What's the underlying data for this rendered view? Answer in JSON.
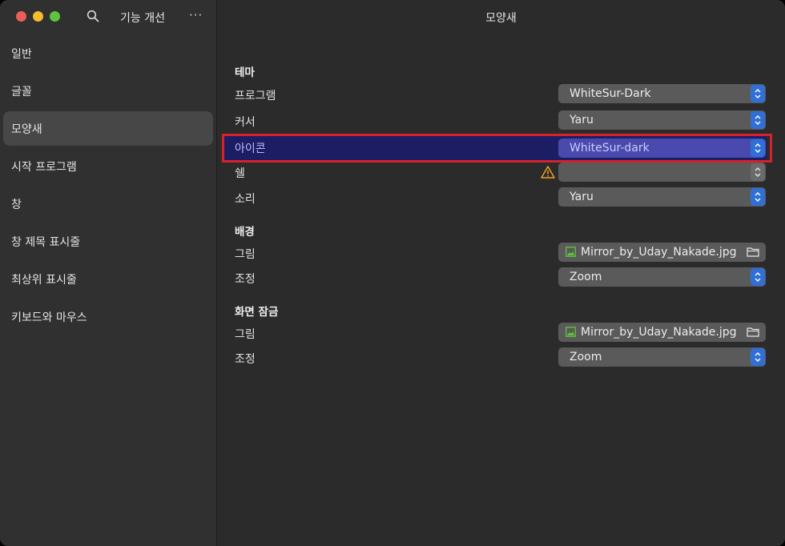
{
  "sidebar": {
    "title": "기능 개선",
    "more_label": "···",
    "items": [
      {
        "label": "일반"
      },
      {
        "label": "글꼴"
      },
      {
        "label": "모양새"
      },
      {
        "label": "시작 프로그램"
      },
      {
        "label": "창"
      },
      {
        "label": "창 제목 표시줄"
      },
      {
        "label": "최상위 표시줄"
      },
      {
        "label": "키보드와 마우스"
      }
    ],
    "active_index": 2
  },
  "main": {
    "title": "모양새",
    "theme": {
      "heading": "테마",
      "program_label": "프로그램",
      "program_value": "WhiteSur-Dark",
      "cursor_label": "커서",
      "cursor_value": "Yaru",
      "icon_label": "아이콘",
      "icon_value": "WhiteSur-dark",
      "shell_label": "쉘",
      "shell_value": "",
      "sound_label": "소리",
      "sound_value": "Yaru"
    },
    "background": {
      "heading": "배경",
      "image_label": "그림",
      "image_value": "Mirror_by_Uday_Nakade.jpg",
      "adjust_label": "조정",
      "adjust_value": "Zoom"
    },
    "lockscreen": {
      "heading": "화면 잠금",
      "image_label": "그림",
      "image_value": "Mirror_by_Uday_Nakade.jpg",
      "adjust_label": "조정",
      "adjust_value": "Zoom"
    }
  },
  "colors": {
    "accent": "#2f6fd6",
    "highlight_fill": "#1c1d63",
    "highlight_border": "#d5222c",
    "warning": "#f0a020"
  },
  "icons": [
    "search-icon",
    "more-icon",
    "warning-icon",
    "image-icon",
    "folder-icon",
    "updown-chevron-icon"
  ]
}
